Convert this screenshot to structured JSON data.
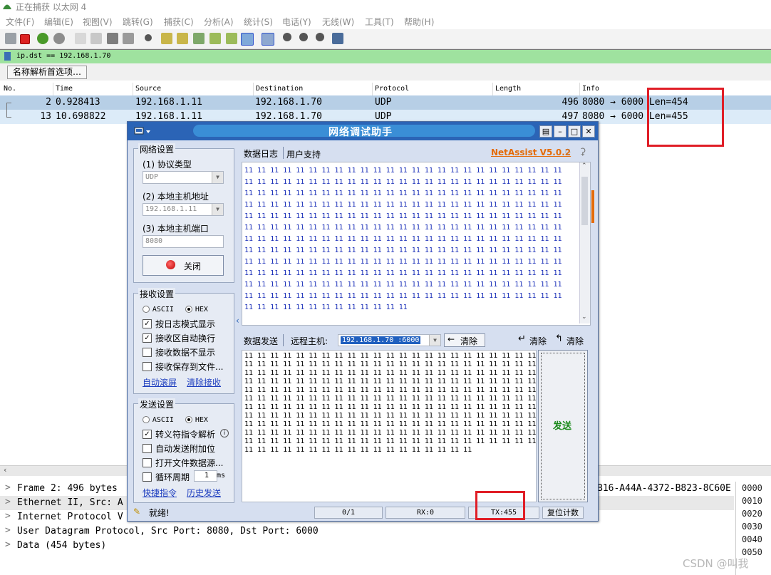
{
  "wireshark": {
    "title": "正在捕获 以太网 4",
    "menu": [
      "文件(F)",
      "编辑(E)",
      "视图(V)",
      "跳转(G)",
      "捕获(C)",
      "分析(A)",
      "统计(S)",
      "电话(Y)",
      "无线(W)",
      "工具(T)",
      "帮助(H)"
    ],
    "filter": "ip.dst == 192.168.1.70",
    "name_resolve_button": "名称解析首选项…",
    "columns": [
      "No.",
      "Time",
      "Source",
      "Destination",
      "Protocol",
      "Length",
      "Info"
    ],
    "packets": [
      {
        "no": "2",
        "time": "0.928413",
        "source": "192.168.1.11",
        "destination": "192.168.1.70",
        "protocol": "UDP",
        "length": "496",
        "info": "8080 → 6000 Len=454"
      },
      {
        "no": "13",
        "time": "10.698822",
        "source": "192.168.1.11",
        "destination": "192.168.1.70",
        "protocol": "UDP",
        "length": "497",
        "info": "8080 → 6000 Len=455"
      }
    ],
    "details": [
      "Frame 2: 496 bytes",
      "Ethernet II, Src: A",
      "Internet Protocol V",
      "User Datagram Protocol, Src Port: 8080, Dst Port: 6000",
      "Data (454 bytes)"
    ],
    "detail_right_text": "B16-A44A-4372-B823-8C60E",
    "hex_offsets": [
      "0000",
      "0010",
      "0020",
      "0030",
      "0040",
      "0050"
    ],
    "watermark": "CSDN @叫我"
  },
  "netassist": {
    "title": "网络调试助手",
    "brand": "NetAssist V5.0.2",
    "net_settings": {
      "title": "网络设置",
      "protocol_label": "(1) 协议类型",
      "protocol_value": "UDP",
      "host_addr_label": "(2) 本地主机地址",
      "host_addr_value": "192.168.1.11",
      "host_port_label": "(3) 本地主机端口",
      "host_port_value": "8080",
      "close_button": "关闭"
    },
    "recv_settings": {
      "title": "接收设置",
      "ascii": "ASCII",
      "hex": "HEX",
      "opt1": "按日志模式显示",
      "opt2": "接收区自动换行",
      "opt3": "接收数据不显示",
      "opt4": "接收保存到文件...",
      "link1": "自动滚屏",
      "link2": "清除接收"
    },
    "send_settings": {
      "title": "发送设置",
      "ascii": "ASCII",
      "hex": "HEX",
      "opt1": "转义符指令解析",
      "opt2": "自动发送附加位",
      "opt3": "打开文件数据源...",
      "opt4": "循环周期",
      "period": "1",
      "unit": "ms",
      "link1": "快捷指令",
      "link2": "历史发送"
    },
    "tabs": {
      "log": "数据日志",
      "support": "用户支持"
    },
    "send_bar": {
      "tab": "数据发送",
      "remote_label": "远程主机:",
      "remote_value": "192.168.1.70 :6000",
      "clear1": "清除",
      "clear2": "清除",
      "clear3": "清除"
    },
    "send_button": "发送",
    "rx_text": "11 11 11 11 11 11 11 11 11 11 11 11 11 11 11 11 11 11 11 11 11 11 11 11 11\n11 11 11 11 11 11 11 11 11 11 11 11 11 11 11 11 11 11 11 11 11 11 11 11 11\n11 11 11 11 11 11 11 11 11 11 11 11 11 11 11 11 11 11 11 11 11 11 11 11 11\n11 11 11 11 11 11 11 11 11 11 11 11 11 11 11 11 11 11 11 11 11 11 11 11 11\n11 11 11 11 11 11 11 11 11 11 11 11 11 11 11 11 11 11 11 11 11 11 11 11 11\n11 11 11 11 11 11 11 11 11 11 11 11 11 11 11 11 11 11 11 11 11 11 11 11 11\n11 11 11 11 11 11 11 11 11 11 11 11 11 11 11 11 11 11 11 11 11 11 11 11 11\n11 11 11 11 11 11 11 11 11 11 11 11 11 11 11 11 11 11 11 11 11 11 11 11 11\n11 11 11 11 11 11 11 11 11 11 11 11 11 11 11 11 11 11 11 11 11 11 11 11 11\n11 11 11 11 11 11 11 11 11 11 11 11 11 11 11 11 11 11 11 11 11 11 11 11 11\n11 11 11 11 11 11 11 11 11 11 11 11 11 11 11 11 11 11 11 11 11 11 11 11 11\n11 11 11 11 11 11 11 11 11 11 11 11 11 11 11 11 11 11 11 11 11 11 11 11 11\n11 11 11 11 11 11 11 11 11 11 11 11 11",
    "tx_text": "11 11 11 11 11 11 11 11 11 11 11 11 11 11 11 11 11 11 11 11 11 11 11 11 11\n11 11 11 11 11 11 11 11 11 11 11 11 11 11 11 11 11 11 11 11 11 11 11 11 11\n11 11 11 11 11 11 11 11 11 11 11 11 11 11 11 11 11 11 11 11 11 11 11 11 11\n11 11 11 11 11 11 11 11 11 11 11 11 11 11 11 11 11 11 11 11 11 11 11 11 11\n11 11 11 11 11 11 11 11 11 11 11 11 11 11 11 11 11 11 11 11 11 11 11 11 11\n11 11 11 11 11 11 11 11 11 11 11 11 11 11 11 11 11 11 11 11 11 11 11 11 11\n11 11 11 11 11 11 11 11 11 11 11 11 11 11 11 11 11 11 11 11 11 11 11 11 11\n11 11 11 11 11 11 11 11 11 11 11 11 11 11 11 11 11 11 11 11 11 11 11 11 11\n11 11 11 11 11 11 11 11 11 11 11 11 11 11 11 11 11 11 11 11 11 11 11 11 11\n11 11 11 11 11 11 11 11 11 11 11 11 11 11 11 11 11 11 11 11 11 11 11 11 11\n11 11 11 11 11 11 11 11 11 11 11 11 11 11 11 11 11 11 11 11 11 11 11 11 11\n11 11 11 11 11 11 11 11 11 11 11 11 11 11 11 11 11 11",
    "status": {
      "ready": "就绪!",
      "count": "0/1",
      "rx": "RX:0",
      "tx": "TX:455",
      "reset": "复位计数"
    }
  },
  "colors": {
    "highlight_box": "#e01e27",
    "filter_bg": "#9fe29f",
    "row_selected": "#b7cfe6",
    "accent": "#2b64b6"
  }
}
